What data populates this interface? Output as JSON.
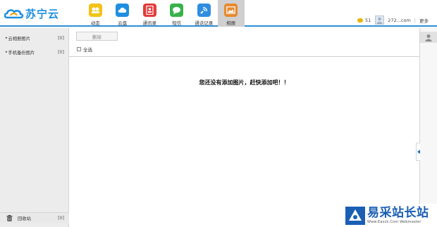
{
  "header": {
    "brand": "苏宁云",
    "nav": [
      {
        "label": "动态",
        "icon": "activity-icon",
        "color": "#f2c318"
      },
      {
        "label": "云盘",
        "icon": "cloud-icon",
        "color": "#1e8fe0"
      },
      {
        "label": "通讯录",
        "icon": "contacts-icon",
        "color": "#e33b3b"
      },
      {
        "label": "短信",
        "icon": "message-icon",
        "color": "#37b24a"
      },
      {
        "label": "通话记录",
        "icon": "call-log-icon",
        "color": "#2f8ee0"
      },
      {
        "label": "相册",
        "icon": "album-icon",
        "color": "#e58a2e",
        "active": true
      }
    ],
    "coins": "51",
    "account": "272...com",
    "more": "更多"
  },
  "sidebar": {
    "items": [
      {
        "label": "云相册图片",
        "count": "[0]"
      },
      {
        "label": "手机备份图片",
        "count": "[0]"
      }
    ],
    "recycle": {
      "label": "回收站",
      "count": "[0]"
    }
  },
  "main": {
    "delete_label": "删除",
    "select_all_label": "全选",
    "empty_message": "您还没有添加图片，赶快添加吧！！"
  },
  "watermark": {
    "title": "易采站长站",
    "subtitle": "Www.Easck.Com Webmaster"
  }
}
